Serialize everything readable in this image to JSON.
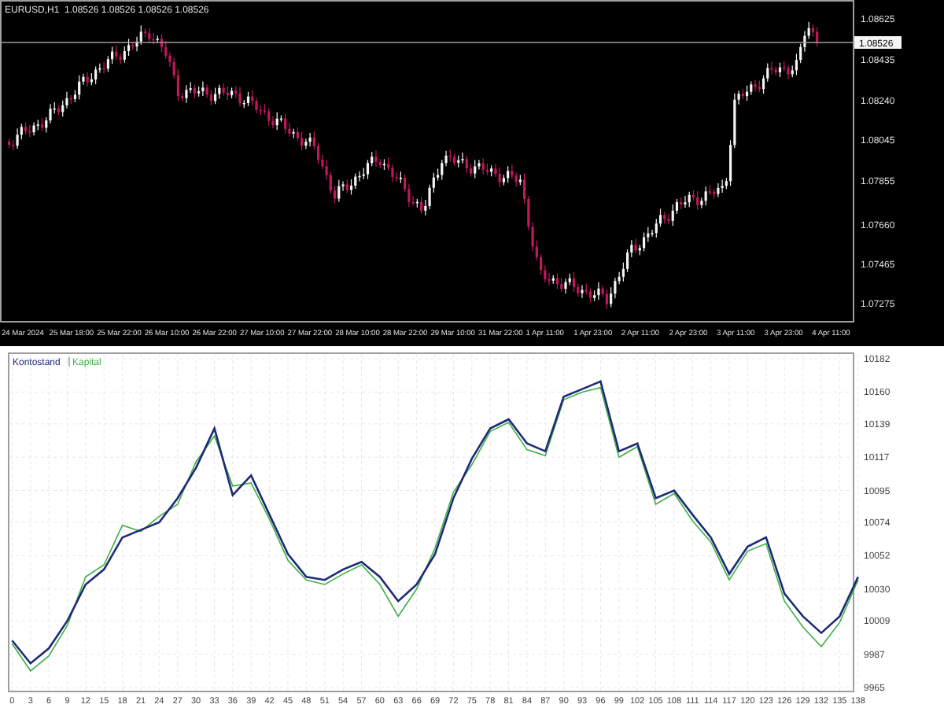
{
  "price_chart": {
    "symbol": "EURUSD,H1",
    "quote": "1.08526 1.08526 1.08526 1.08526",
    "current_price": "1.08526",
    "price_labels": [
      "1.08625",
      "1.08435",
      "1.08240",
      "1.08045",
      "1.07855",
      "1.07660",
      "1.07465",
      "1.07275"
    ],
    "time_labels": [
      "24 Mar 2024",
      "25 Mar 18:00",
      "25 Mar 22:00",
      "26 Mar 10:00",
      "26 Mar 22:00",
      "27 Mar 10:00",
      "27 Mar 22:00",
      "28 Mar 10:00",
      "28 Mar 22:00",
      "29 Mar 10:00",
      "31 Mar 22:00",
      "1 Apr 11:00",
      "1 Apr 23:00",
      "2 Apr 11:00",
      "2 Apr 23:00",
      "3 Apr 11:00",
      "3 Apr 23:00",
      "4 Apr 11:00"
    ]
  },
  "balance_chart": {
    "chart_data": {
      "type": "line",
      "x": [
        0,
        3,
        6,
        9,
        12,
        15,
        18,
        21,
        24,
        27,
        30,
        33,
        36,
        39,
        42,
        45,
        48,
        51,
        54,
        57,
        60,
        63,
        66,
        69,
        72,
        75,
        78,
        81,
        84,
        87,
        90,
        93,
        96,
        99,
        102,
        105,
        108,
        111,
        114,
        117,
        120,
        123,
        126,
        129,
        132,
        135,
        138
      ],
      "xticks": [
        0,
        3,
        6,
        9,
        12,
        15,
        18,
        21,
        24,
        27,
        30,
        33,
        36,
        39,
        42,
        45,
        48,
        51,
        54,
        57,
        60,
        63,
        66,
        69,
        72,
        75,
        78,
        81,
        84,
        87,
        90,
        93,
        96,
        99,
        102,
        105,
        108,
        111,
        114,
        117,
        120,
        123,
        126,
        129,
        132,
        135,
        138
      ],
      "yticks": [
        9965,
        9987,
        10009,
        10030,
        10052,
        10074,
        10095,
        10117,
        10139,
        10160,
        10182
      ],
      "ylim": [
        9965,
        10182
      ],
      "xlim": [
        0,
        138
      ],
      "grid": true,
      "series": [
        {
          "name": "Kontostand",
          "color": "#1e2a78",
          "values": [
            9996,
            9981,
            9991,
            10009,
            10033,
            10043,
            10064,
            10069,
            10074,
            10090,
            10110,
            10136,
            10092,
            10105,
            10079,
            10053,
            10038,
            10036,
            10043,
            10048,
            10038,
            10022,
            10033,
            10053,
            10090,
            10116,
            10136,
            10142,
            10126,
            10121,
            10157,
            10162,
            10167,
            10121,
            10126,
            10090,
            10095,
            10079,
            10064,
            10040,
            10058,
            10064,
            10027,
            10012,
            10001,
            10012,
            10038
          ]
        },
        {
          "name": "Kapital",
          "color": "#3cb043",
          "values": [
            9994,
            9976,
            9986,
            10006,
            10038,
            10046,
            10072,
            10068,
            10078,
            10086,
            10114,
            10131,
            10098,
            10100,
            10076,
            10049,
            10036,
            10033,
            10040,
            10046,
            10033,
            10012,
            10030,
            10057,
            10094,
            10112,
            10134,
            10140,
            10122,
            10118,
            10155,
            10160,
            10163,
            10117,
            10124,
            10086,
            10093,
            10075,
            10061,
            10036,
            10055,
            10060,
            10022,
            10005,
            9992,
            10008,
            10036
          ]
        }
      ]
    }
  }
}
